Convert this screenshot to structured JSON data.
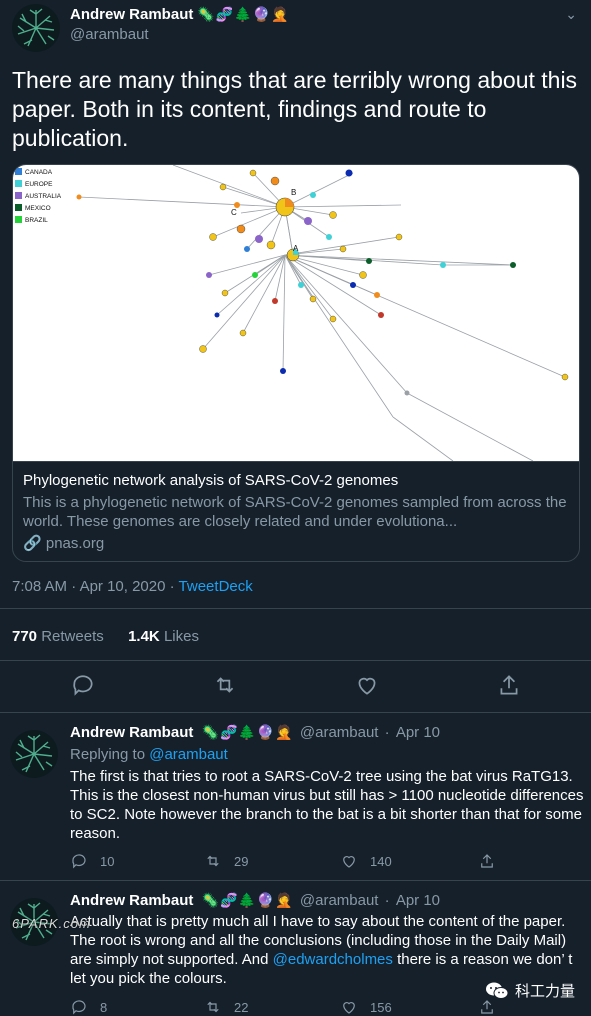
{
  "tweet": {
    "author_name": "Andrew Rambaut",
    "author_emojis": "🦠🧬🌲🔮🤦",
    "handle": "@arambaut",
    "text": "There are many things that are terribly wrong about this paper. Both in its content, findings and route to publication.",
    "card": {
      "title": "Phylogenetic network analysis of SARS-CoV-2 genomes",
      "description": "This is a phylogenetic network of SARS-CoV-2 genomes sampled from across the world. These genomes are closely related and under evolutiona...",
      "domain": "pnas.org",
      "legend": [
        "CANADA",
        "EUROPE",
        "AUSTRALIA",
        "MEXICO",
        "BRAZIL"
      ],
      "legend_colors": [
        "#2f7fd6",
        "#3fd1d6",
        "#8b64c9",
        "#0b5d2a",
        "#26d23a"
      ],
      "node_labels": [
        "B",
        "C",
        "A"
      ]
    },
    "time": "7:08 AM",
    "date": "Apr 10, 2020",
    "source": "TweetDeck",
    "retweets_count": "770",
    "retweets_label": "Retweets",
    "likes_count": "1.4K",
    "likes_label": "Likes"
  },
  "replies": [
    {
      "author_name": "Andrew Rambaut",
      "author_emojis": "🦠🧬🌲🔮🤦",
      "handle": "@arambaut",
      "date": "Apr 10",
      "replying_prefix": "Replying to ",
      "replying_to": "@arambaut",
      "text": "The first is that tries to root a SARS-CoV-2 tree using the bat virus RaTG13. This is the closest non-human virus but still has > 1100 nucleotide differences to SC2. Note however the branch to the bat is a bit shorter than that for some reason.",
      "reply_count": "10",
      "retweet_count": "29",
      "like_count": "140"
    },
    {
      "author_name": "Andrew Rambaut",
      "author_emojis": "🦠🧬🌲🔮🤦",
      "handle": "@arambaut",
      "date": "Apr 10",
      "text_before": "Actually that is pretty much all I have to say about the content of the paper. The root is wrong and all the conclusions (including those in the Daily Mail) are simply not supported.  And ",
      "mention": "@edwardcholmes",
      "text_after": " there is a reason we don’ t let you pick the colours.",
      "reply_count": "8",
      "retweet_count": "22",
      "like_count": "156"
    }
  ],
  "overlay": {
    "stamp": "6PARK.com",
    "watermark": "科工力量"
  }
}
